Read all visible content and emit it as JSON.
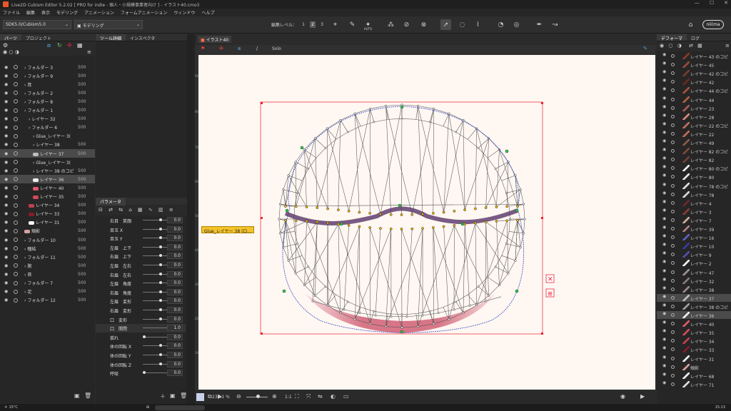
{
  "window": {
    "title": "Live2D Cubism Editor 5.2.02   [ PRO for indie - 個人・小規模事業者向け ]   - イラスト40.cmo3",
    "controls": [
      "—",
      "☐",
      "✕"
    ]
  },
  "menu": [
    "ファイル",
    "編集",
    "表示",
    "モデリング",
    "アニメーション",
    "フォームアニメーション",
    "ウィンドウ",
    "ヘルプ"
  ],
  "toolbar": {
    "sdk_select": "SDK5.0/Cubism5.0",
    "mode_select": "モデリング",
    "edit_level_label": "編集レベル：",
    "edit_levels": [
      "1",
      "2",
      "3"
    ],
    "user_badge": "nii(ma",
    "auto_label": "AUTO"
  },
  "left_panel": {
    "tabs": [
      "パーツ",
      "プロジェクト"
    ],
    "rows": [
      {
        "label": "フォルダー 3",
        "opacity": "500",
        "indent": 1,
        "swatch": ""
      },
      {
        "label": "フォルダー 9",
        "opacity": "500",
        "indent": 1,
        "swatch": ""
      },
      {
        "label": "耳",
        "opacity": "500",
        "indent": 1,
        "swatch": ""
      },
      {
        "label": "フォルダー 2",
        "opacity": "500",
        "indent": 1,
        "swatch": ""
      },
      {
        "label": "フォルダー 8",
        "opacity": "500",
        "indent": 1,
        "swatch": ""
      },
      {
        "label": "フォルダー 1",
        "opacity": "500",
        "indent": 1,
        "swatch": ""
      },
      {
        "label": "レイヤー 32",
        "opacity": "500",
        "indent": 2,
        "swatch": ""
      },
      {
        "label": "フォルダー 6",
        "opacity": "500",
        "indent": 2,
        "swatch": ""
      },
      {
        "label": "Glue_レイヤー 3(",
        "opacity": "",
        "indent": 3,
        "swatch": ""
      },
      {
        "label": "レイヤー 38",
        "opacity": "500",
        "indent": 3,
        "swatch": ""
      },
      {
        "label": "レイヤー 37",
        "opacity": "500",
        "indent": 3,
        "swatch": "#bdbdbd",
        "selected": true
      },
      {
        "label": "Glue_レイヤー 3(",
        "opacity": "",
        "indent": 3,
        "swatch": ""
      },
      {
        "label": "レイヤー 38 のコピ",
        "opacity": "500",
        "indent": 3,
        "swatch": ""
      },
      {
        "label": "レイヤー 36",
        "opacity": "500",
        "indent": 3,
        "swatch": "#f0f0f0",
        "selected": true
      },
      {
        "label": "レイヤー 40",
        "opacity": "500",
        "indent": 3,
        "swatch": "#e05a6a"
      },
      {
        "label": "レイヤー 35",
        "opacity": "500",
        "indent": 3,
        "swatch": "#d24a5a"
      },
      {
        "label": "レイヤー 34",
        "opacity": "500",
        "indent": 2,
        "swatch": "#c04050"
      },
      {
        "label": "レイヤー 33",
        "opacity": "500",
        "indent": 2,
        "swatch": "#8a1a2a"
      },
      {
        "label": "レイヤー 31",
        "opacity": "500",
        "indent": 2,
        "swatch": "#f5f5f5"
      },
      {
        "label": "頬影",
        "opacity": "500",
        "indent": 1,
        "swatch": "#d9a0a0"
      },
      {
        "label": "フォルダー 10",
        "opacity": "500",
        "indent": 1,
        "swatch": ""
      },
      {
        "label": "瞳結",
        "opacity": "500",
        "indent": 1,
        "swatch": ""
      },
      {
        "label": "フォルダー 11",
        "opacity": "500",
        "indent": 1,
        "swatch": ""
      },
      {
        "label": "腕",
        "opacity": "500",
        "indent": 1,
        "swatch": ""
      },
      {
        "label": "首",
        "opacity": "500",
        "indent": 1,
        "swatch": ""
      },
      {
        "label": "フォルダー 7",
        "opacity": "500",
        "indent": 1,
        "swatch": ""
      },
      {
        "label": "足",
        "opacity": "500",
        "indent": 1,
        "swatch": ""
      },
      {
        "label": "フォルダー 12",
        "opacity": "500",
        "indent": 1,
        "swatch": ""
      }
    ]
  },
  "mid_panel": {
    "tabs": [
      "ツール詳細",
      "インスペクタ"
    ],
    "param_tab": "パラメータ",
    "params": [
      {
        "label": "右目　笑顔",
        "value": "0.0",
        "knob": 0.5
      },
      {
        "label": "目玉 X",
        "value": "0.0",
        "knob": 0.5
      },
      {
        "label": "目玉 Y",
        "value": "0.0",
        "knob": 0.5
      },
      {
        "label": "左眉　上下",
        "value": "0.0",
        "knob": 0.5
      },
      {
        "label": "右眉　上下",
        "value": "0.0",
        "knob": 0.5
      },
      {
        "label": "左眉　左右",
        "value": "0.0",
        "knob": 0.5
      },
      {
        "label": "右眉　左右",
        "value": "0.0",
        "knob": 0.5
      },
      {
        "label": "左眉　角度",
        "value": "0.0",
        "knob": 0.5
      },
      {
        "label": "右眉　角度",
        "value": "0.0",
        "knob": 0.5
      },
      {
        "label": "左眉　変形",
        "value": "0.0",
        "knob": 0.5
      },
      {
        "label": "右眉　変形",
        "value": "0.0",
        "knob": 0.5
      },
      {
        "label": "口　変形",
        "value": "0.0",
        "knob": 0.5
      },
      {
        "label": "口　開閉",
        "value": "1.0",
        "knob": 1.0,
        "active": true
      },
      {
        "label": "揺れ",
        "value": "0.0",
        "knob": 0.0
      },
      {
        "label": "体の回転 X",
        "value": "0.0",
        "knob": 0.5
      },
      {
        "label": "体の回転 Y",
        "value": "0.0",
        "knob": 0.5
      },
      {
        "label": "体の回転 Z",
        "value": "0.0",
        "knob": 0.5
      },
      {
        "label": "呼吸",
        "value": "0.0",
        "knob": 0.0
      }
    ]
  },
  "document": {
    "tab": "イラスト40",
    "solo_label": "Solo",
    "ruler_marks": [
      "900",
      "800",
      "700",
      "600",
      "500",
      "400",
      "300",
      "200",
      "100"
    ],
    "selection_tag": "Glue_レイヤー 38 (ロ...",
    "zoom": "237.1 %",
    "ratio": "1:1"
  },
  "right_panel": {
    "tabs": [
      "デフォーマ",
      "ログ"
    ],
    "rows": [
      {
        "label": "レイヤー 43 のコピ",
        "color": "#8a3a2a"
      },
      {
        "label": "レイヤー 45",
        "color": "#9a4a3a"
      },
      {
        "label": "レイヤー 42 のコピ",
        "color": "#7a3a30"
      },
      {
        "label": "レイヤー 42",
        "color": "#6a2a22"
      },
      {
        "label": "レイヤー 44 のコピ",
        "color": "#a8523a"
      },
      {
        "label": "レイヤー 44",
        "color": "#b06040"
      },
      {
        "label": "レイヤー 23",
        "color": "#a85a5a"
      },
      {
        "label": "レイヤー 28",
        "color": "#d98a7a"
      },
      {
        "label": "レイヤー 22 のコピ",
        "color": "#c07060"
      },
      {
        "label": "レイヤー 22",
        "color": "#c46a5a"
      },
      {
        "label": "レイヤー 49",
        "color": "#8a5a4a"
      },
      {
        "label": "レイヤー 82 のコピ",
        "color": "#7a4a3a"
      },
      {
        "label": "レイヤー 82",
        "color": "#704036"
      },
      {
        "label": "レイヤー 80 のコピ",
        "color": "#f0f0f0"
      },
      {
        "label": "レイヤー 80",
        "color": "#e8e8e8"
      },
      {
        "label": "レイヤー 78 のコピ",
        "color": "#e0e0e0"
      },
      {
        "label": "レイヤー 78",
        "color": "#d8d8d8"
      },
      {
        "label": "レイヤー 4",
        "color": "#6a2a2a"
      },
      {
        "label": "レイヤー 3",
        "color": "#8a3a3a"
      },
      {
        "label": "レイヤー 7",
        "color": "#d0b0a0"
      },
      {
        "label": "レイヤー 39",
        "color": "#b08080"
      },
      {
        "label": "レイヤー 16",
        "color": "#6060c0"
      },
      {
        "label": "レイヤー 10",
        "color": "#3a3aa0"
      },
      {
        "label": "レイヤー 9",
        "color": "#5050b0"
      },
      {
        "label": "レイヤー 2",
        "color": "#f4f4f4"
      },
      {
        "label": "レイヤー 47",
        "color": "#a09090"
      },
      {
        "label": "レイヤー 32",
        "color": "#8a7a7a"
      },
      {
        "label": "レイヤー 38",
        "color": "#9a8a8a"
      },
      {
        "label": "レイヤー 37",
        "color": "#bdbdbd",
        "selected": true
      },
      {
        "label": "レイヤー 38 のコピ",
        "color": "#a0a0a0"
      },
      {
        "label": "レイヤー 36",
        "color": "#f0f0f0",
        "selected": true
      },
      {
        "label": "レイヤー 40",
        "color": "#e05a6a"
      },
      {
        "label": "レイヤー 35",
        "color": "#d24a5a"
      },
      {
        "label": "レイヤー 34",
        "color": "#c04050"
      },
      {
        "label": "レイヤー 33",
        "color": "#8a1a2a"
      },
      {
        "label": "レイヤー 31",
        "color": "#f5f5f5"
      },
      {
        "label": "頬影",
        "color": "#d9a0a0"
      },
      {
        "label": "レイヤー 68",
        "color": "#f0f0f0"
      },
      {
        "label": "レイヤー 71",
        "color": "#e0e0e0"
      }
    ]
  },
  "taskbar": {
    "weather": "15°C",
    "time": "15:13"
  }
}
